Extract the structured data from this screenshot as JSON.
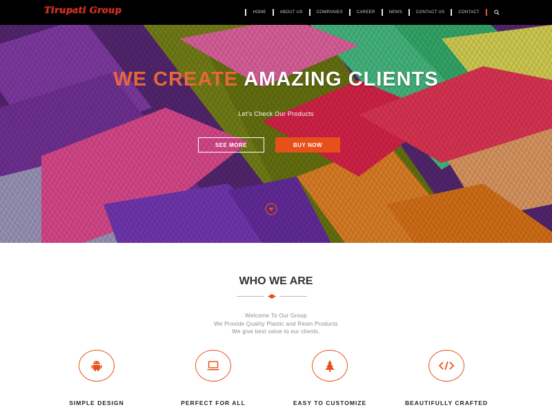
{
  "brand": {
    "logo_text": "Tirupati Group"
  },
  "nav": {
    "items": [
      {
        "label": "HOME"
      },
      {
        "label": "ABOUT US"
      },
      {
        "label": "COMPANIES"
      },
      {
        "label": "CAREER"
      },
      {
        "label": "NEWS"
      },
      {
        "label": "CONTACT US"
      },
      {
        "label": "CONTACT"
      }
    ],
    "search_icon": "search-icon"
  },
  "hero": {
    "title_accent": "WE CREATE",
    "title_rest": "AMAZING CLIENTS",
    "subtitle": "Let's Check Our Products",
    "see_more_label": "SEE MORE",
    "buy_now_label": "BUY NOW",
    "scroll_icon": "chevron-down-icon"
  },
  "about": {
    "title": "WHO WE ARE",
    "lines": [
      "Welcome To Our Group",
      "We Provide Quality Plastic and Resin Products",
      "We give best value to our clients."
    ]
  },
  "features": [
    {
      "label": "SIMPLE DESIGN",
      "icon": "android-icon"
    },
    {
      "label": "PERFECT FOR ALL",
      "icon": "laptop-icon"
    },
    {
      "label": "EASY TO CUSTOMIZE",
      "icon": "tree-icon"
    },
    {
      "label": "BEAUTIFULLY CRAFTED",
      "icon": "code-icon"
    }
  ],
  "colors": {
    "accent": "#e8501a",
    "nav_bg": "#000000",
    "logo": "#e0281c"
  }
}
